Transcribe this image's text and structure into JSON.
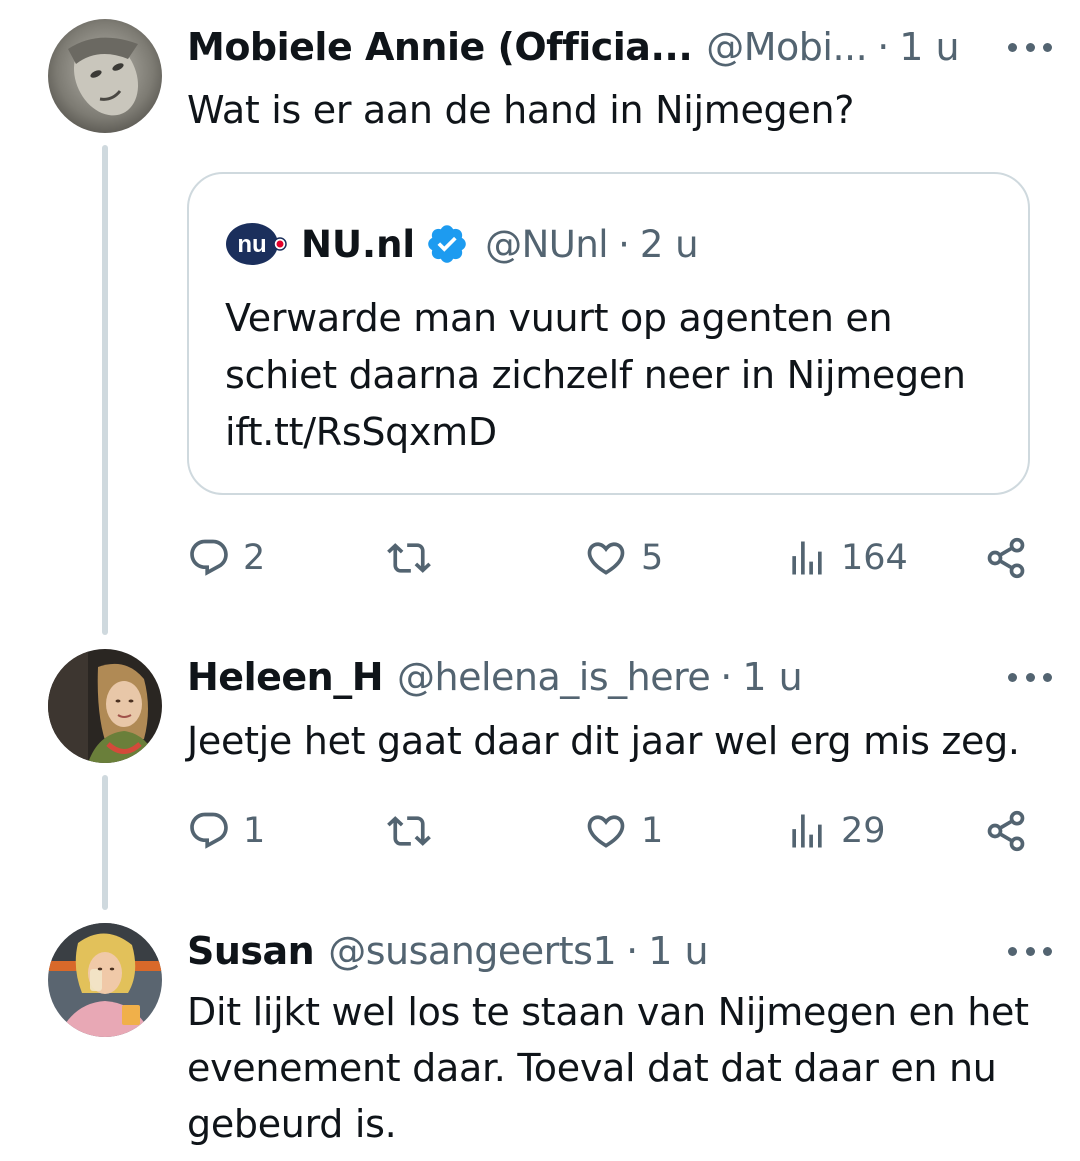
{
  "tweets": [
    {
      "name": "Mobiele Annie (Officia...",
      "handle": "@Mobi...",
      "dot": "·",
      "time": "1 u",
      "text": "Wat is er aan de hand in Nijmegen?",
      "quote": {
        "name": "NU.nl",
        "handle": "@NUnl",
        "dot": "·",
        "time": "2 u",
        "text": "Verwarde man vuurt op agenten en schiet daarna zichzelf neer in Nijmegen ift.tt/RsSqxmD",
        "logo_text": "nu"
      },
      "actions": {
        "replies": "2",
        "retweets": "",
        "likes": "5",
        "views": "164"
      }
    },
    {
      "name": "Heleen_H",
      "handle": "@helena_is_here",
      "dot": "·",
      "time": "1 u",
      "text": "Jeetje het gaat daar dit jaar wel erg mis zeg.",
      "actions": {
        "replies": "1",
        "retweets": "",
        "likes": "1",
        "views": "29"
      }
    },
    {
      "name": "Susan",
      "handle": "@susangeerts1",
      "dot": "·",
      "time": "1 u",
      "text": "Dit lijkt wel los te staan van Nijmegen en het evenement daar. Toeval dat dat daar en nu gebeurd is."
    }
  ],
  "icons": {
    "reply": "reply-icon",
    "retweet": "retweet-icon",
    "like": "heart-icon",
    "views": "views-icon",
    "share": "share-icon",
    "more": "more-icon",
    "verified": "verified-badge-icon"
  },
  "colors": {
    "text": "#0f1419",
    "secondary": "#536471",
    "border": "#cfd9de",
    "verified": "#1d9bf0",
    "nu_logo": "#1b2f5c",
    "nu_logo_dot": "#e4002b"
  }
}
